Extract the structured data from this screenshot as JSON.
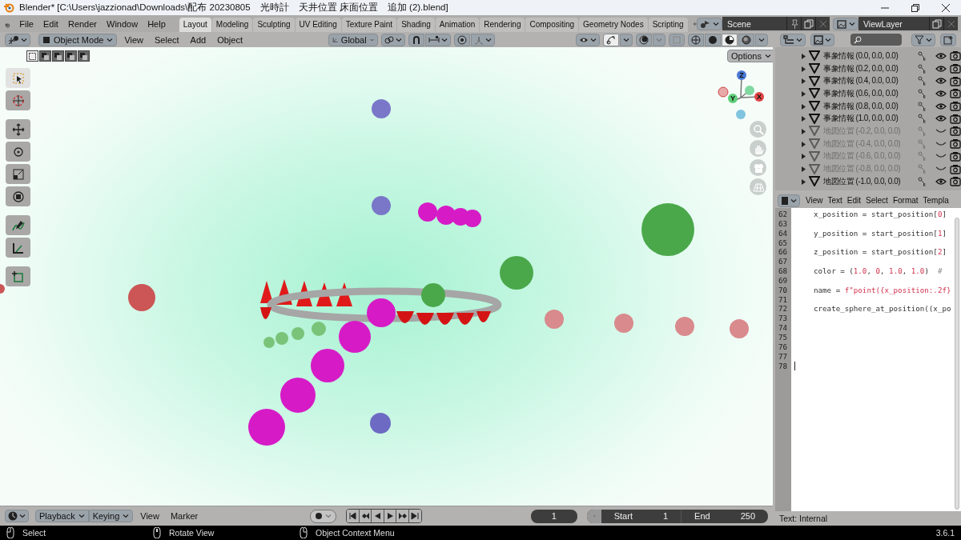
{
  "window": {
    "title": "Blender* [C:\\Users\\jazzionad\\Downloads\\配布 20230805　光時計　天井位置 床面位置　追加 (2).blend]"
  },
  "menu": [
    "File",
    "Edit",
    "Render",
    "Window",
    "Help"
  ],
  "workspace_tabs": [
    {
      "label": "Layout",
      "selected": true
    },
    {
      "label": "Modeling",
      "selected": false
    },
    {
      "label": "Sculpting",
      "selected": false
    },
    {
      "label": "UV Editing",
      "selected": false
    },
    {
      "label": "Texture Paint",
      "selected": false
    },
    {
      "label": "Shading",
      "selected": false
    },
    {
      "label": "Animation",
      "selected": false
    },
    {
      "label": "Rendering",
      "selected": false
    },
    {
      "label": "Compositing",
      "selected": false
    },
    {
      "label": "Geometry Nodes",
      "selected": false
    },
    {
      "label": "Scripting",
      "selected": false
    }
  ],
  "scene": "Scene",
  "view_layer": "ViewLayer",
  "viewport_header": {
    "mode": "Object Mode",
    "menus": [
      "View",
      "Select",
      "Add",
      "Object"
    ],
    "orientation": "Global"
  },
  "viewport": {
    "options": "Options",
    "gizmo_axes": [
      "Z",
      "Y",
      "X"
    ]
  },
  "outliner": {
    "items": [
      {
        "name": "事象情報 (0.0, 0.0, 0.0)",
        "visible": true
      },
      {
        "name": "事象情報 (0.2, 0.0, 0.0)",
        "visible": true
      },
      {
        "name": "事象情報 (0.4, 0.0, 0.0)",
        "visible": true
      },
      {
        "name": "事象情報 (0.6, 0.0, 0.0)",
        "visible": true
      },
      {
        "name": "事象情報 (0.8, 0.0, 0.0)",
        "visible": true
      },
      {
        "name": "事象情報 (1.0, 0.0, 0.0)",
        "visible": true
      },
      {
        "name": "地図位置 (-0.2, 0.0, 0.0)",
        "visible": false
      },
      {
        "name": "地図位置 (-0.4, 0.0, 0.0)",
        "visible": false
      },
      {
        "name": "地図位置 (-0.6, 0.0, 0.0)",
        "visible": false
      },
      {
        "name": "地図位置 (-0.8, 0.0, 0.0)",
        "visible": false
      },
      {
        "name": "地図位置 (-1.0, 0.0, 0.0)",
        "visible": true
      }
    ]
  },
  "text_editor": {
    "menus": [
      "View",
      "Text",
      "Edit",
      "Select",
      "Format",
      "Templa"
    ],
    "lines": [
      {
        "number": "62",
        "tokens": [
          {
            "text": "x_position = start_position[",
            "kind": "plain"
          },
          {
            "text": "0",
            "kind": "number"
          },
          {
            "text": "]",
            "kind": "plain"
          }
        ]
      },
      {
        "number": "63"
      },
      {
        "number": "64",
        "tokens": [
          {
            "text": "y_position = start_position[",
            "kind": "plain"
          },
          {
            "text": "1",
            "kind": "number"
          },
          {
            "text": "]",
            "kind": "plain"
          }
        ]
      },
      {
        "number": "65"
      },
      {
        "number": "66",
        "tokens": [
          {
            "text": "z_position = start_position[",
            "kind": "plain"
          },
          {
            "text": "2",
            "kind": "number"
          },
          {
            "text": "]",
            "kind": "plain"
          }
        ]
      },
      {
        "number": "67"
      },
      {
        "number": "68",
        "tokens": [
          {
            "text": "color = (",
            "kind": "plain"
          },
          {
            "text": "1.0",
            "kind": "number"
          },
          {
            "text": ", ",
            "kind": "plain"
          },
          {
            "text": "0",
            "kind": "number"
          },
          {
            "text": ", ",
            "kind": "plain"
          },
          {
            "text": "1.0",
            "kind": "number"
          },
          {
            "text": ", ",
            "kind": "plain"
          },
          {
            "text": "1.0",
            "kind": "number"
          },
          {
            "text": ")  ",
            "kind": "plain"
          },
          {
            "text": "#",
            "kind": "comment"
          }
        ]
      },
      {
        "number": "69"
      },
      {
        "number": "70",
        "tokens": [
          {
            "text": "name = ",
            "kind": "plain"
          },
          {
            "text": "f\"point({x_position:.2f}",
            "kind": "string"
          }
        ]
      },
      {
        "number": "71"
      },
      {
        "number": "72",
        "tokens": [
          {
            "text": "create_sphere_at_position((x_po",
            "kind": "plain"
          }
        ]
      },
      {
        "number": "73"
      },
      {
        "number": "74"
      },
      {
        "number": "75"
      },
      {
        "number": "76"
      },
      {
        "number": "77"
      },
      {
        "number": "78",
        "cursor": true
      }
    ],
    "footer": "Text: Internal"
  },
  "timeline": {
    "dropdowns": [
      "Playback",
      "Keying"
    ],
    "menus": [
      "View",
      "Marker"
    ],
    "current_frame": "1",
    "start_label": "Start",
    "start": "1",
    "end_label": "End",
    "end": "250"
  },
  "status_bar": {
    "hints": [
      "Select",
      "Rotate View",
      "Object Context Menu"
    ],
    "version": "3.6.1"
  }
}
